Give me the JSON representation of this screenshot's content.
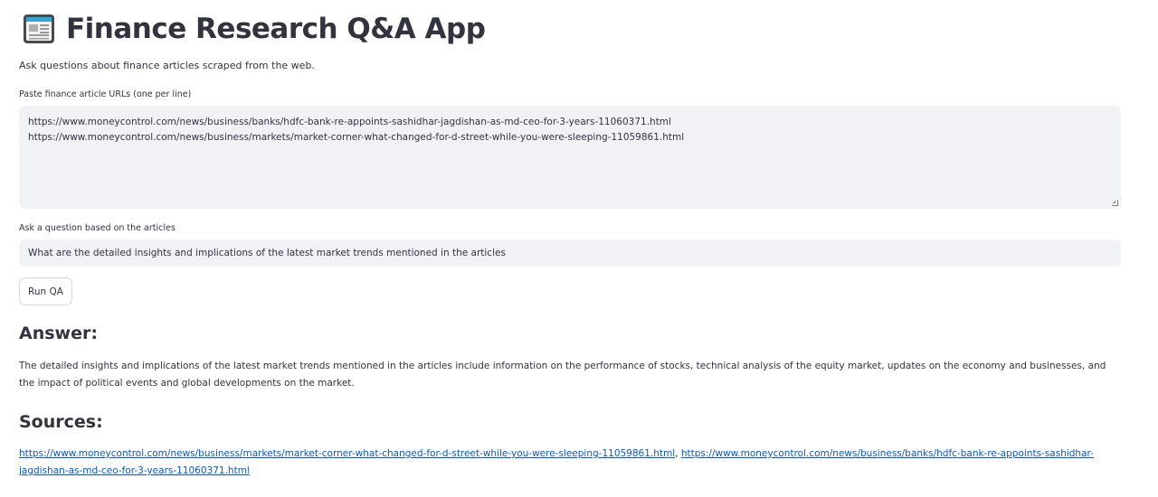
{
  "header": {
    "icon": "newspaper-icon",
    "title": "Finance Research Q&A App"
  },
  "subtitle": "Ask questions about finance articles scraped from the web.",
  "urls_field": {
    "label": "Paste finance article URLs (one per line)",
    "lines": [
      "https://www.moneycontrol.com/news/business/banks/hdfc-bank-re-appoints-sashidhar-jagdishan-as-md-ceo-for-3-years-11060371.html",
      "https://www.moneycontrol.com/news/business/markets/market-corner-what-changed-for-d-street-while-you-were-sleeping-11059861.html"
    ]
  },
  "question_field": {
    "label": "Ask a question based on the articles",
    "value": "What are the detailed insights and implications of the latest market trends mentioned in the articles"
  },
  "run_button": {
    "label": "Run QA"
  },
  "answer": {
    "heading": "Answer:",
    "text": "The detailed insights and implications of the latest market trends mentioned in the articles include information on the performance of stocks, technical analysis of the equity market, updates on the economy and businesses, and the impact of political events and global developments on the market."
  },
  "sources": {
    "heading": "Sources:",
    "links": [
      "https://www.moneycontrol.com/news/business/markets/market-corner-what-changed-for-d-street-while-you-were-sleeping-11059861.html",
      "https://www.moneycontrol.com/news/business/banks/hdfc-bank-re-appoints-sashidhar-jagdishan-as-md-ceo-for-3-years-11060371.html"
    ],
    "separator": ", "
  },
  "colors": {
    "text": "#31333f",
    "input_bg": "#f0f2f6",
    "link": "#0b58c0"
  }
}
